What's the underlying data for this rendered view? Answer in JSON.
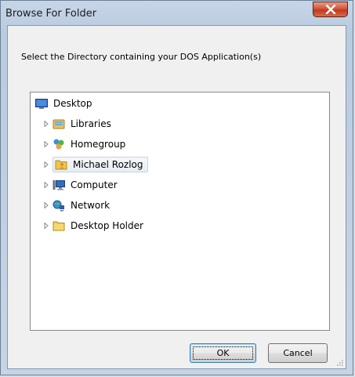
{
  "window": {
    "title": "Browse For Folder"
  },
  "dialog": {
    "instruction": "Select the Directory containing your DOS Application(s)"
  },
  "tree": {
    "items": [
      {
        "label": "Desktop",
        "icon": "desktop-icon",
        "expandable": false
      },
      {
        "label": "Libraries",
        "icon": "libraries-icon",
        "expandable": true
      },
      {
        "label": "Homegroup",
        "icon": "homegroup-icon",
        "expandable": true
      },
      {
        "label": "Michael Rozlog",
        "icon": "user-folder-icon",
        "expandable": true,
        "selected": true
      },
      {
        "label": "Computer",
        "icon": "computer-icon",
        "expandable": true
      },
      {
        "label": "Network",
        "icon": "network-icon",
        "expandable": true
      },
      {
        "label": "Desktop Holder",
        "icon": "folder-icon",
        "expandable": true
      }
    ]
  },
  "buttons": {
    "ok_label": "OK",
    "cancel_label": "Cancel"
  },
  "colors": {
    "close_button": "#c7472b",
    "selection": "#e8edf4"
  }
}
